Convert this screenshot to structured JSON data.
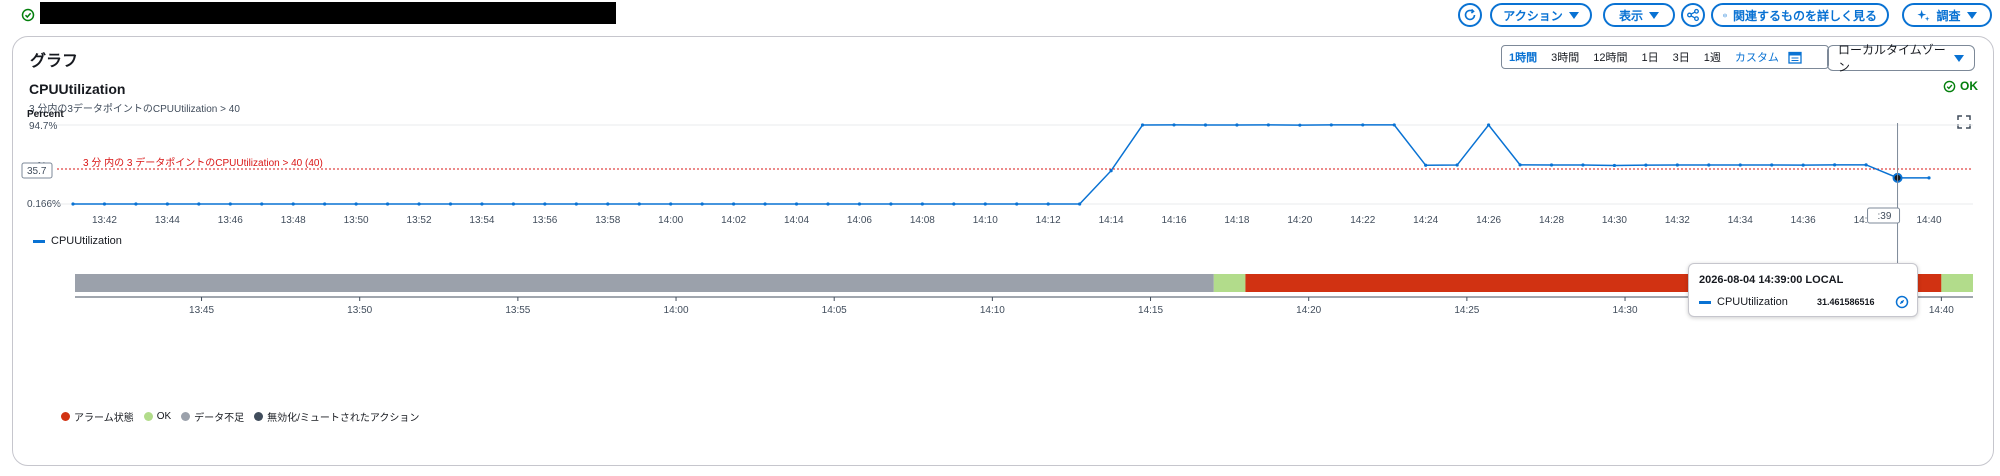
{
  "toolbar": {
    "refresh_icon": "refresh-icon",
    "actions_label": "アクション",
    "view_label": "表示",
    "share_icon": "share-icon",
    "explore_label": "関連するものを詳しく見る",
    "investigate_label": "調査"
  },
  "panel": {
    "title": "グラフ",
    "ranges": [
      "1時間",
      "3時間",
      "12時間",
      "1日",
      "3日",
      "1週"
    ],
    "custom_label": "カスタム",
    "timezone_label": "ローカルタイムゾーン"
  },
  "metric": {
    "title": "CPUUtilization",
    "subtitle": "3 分内の3データポイントのCPUUtilization > 40",
    "status": "OK",
    "y_unit": "Percent",
    "y_top_label": "94.7%",
    "y_mid_label": "...%",
    "y_bottom_label": "0.166%",
    "threshold_label": "3 分 内の 3 データポイントのCPUUtilization > 40 (40)",
    "hover_y_badge": "35.7",
    "hover_x_badge": ":39",
    "legend_series": "CPUUtilization"
  },
  "tooltip": {
    "datetime": "2026-08-04 14:39:00 LOCAL",
    "series": "CPUUtilization",
    "value": "31.461586516"
  },
  "timeline": {
    "legend": [
      {
        "label": "アラーム状態",
        "color": "#d13212"
      },
      {
        "label": "OK",
        "color": "#b2dc8b"
      },
      {
        "label": "データ不足",
        "color": "#9ba1ab"
      },
      {
        "label": "無効化/ミュートされたアクション",
        "color": "#414d5c"
      }
    ],
    "ticks": [
      "13:45",
      "13:50",
      "13:55",
      "14:00",
      "14:05",
      "14:10",
      "14:15",
      "14:20",
      "14:25",
      "14:30",
      "14:35",
      "14:40"
    ],
    "segments": [
      {
        "state": "データ不足",
        "color": "#9ba1ab",
        "from": "13:41",
        "to": "14:17"
      },
      {
        "state": "OK",
        "color": "#b2dc8b",
        "from": "14:17",
        "to": "14:18"
      },
      {
        "state": "アラーム状態",
        "color": "#d13212",
        "from": "14:18",
        "to": "14:40"
      },
      {
        "state": "OK",
        "color": "#b2dc8b",
        "from": "14:40",
        "to": "14:41"
      }
    ]
  },
  "chart_data": {
    "type": "line",
    "title": "CPUUtilization",
    "ylabel": "Percent",
    "threshold": 40,
    "x_tick_labels": [
      "13:42",
      "13:44",
      "13:46",
      "13:48",
      "13:50",
      "13:52",
      "13:54",
      "13:56",
      "13:58",
      "14:00",
      "14:02",
      "14:04",
      "14:06",
      "14:08",
      "14:10",
      "14:12",
      "14:14",
      "14:16",
      "14:18",
      "14:20",
      "14:22",
      "14:24",
      "14:26",
      "14:28",
      "14:30",
      "14:32",
      "14:34",
      "14:36",
      "14:38",
      ":39",
      "14:40"
    ],
    "series": [
      {
        "name": "CPUUtilization",
        "color": "#0972d3",
        "x": [
          "13:41",
          "13:42",
          "13:43",
          "13:44",
          "13:45",
          "13:46",
          "13:47",
          "13:48",
          "13:49",
          "13:50",
          "13:51",
          "13:52",
          "13:53",
          "13:54",
          "13:55",
          "13:56",
          "13:57",
          "13:58",
          "13:59",
          "14:00",
          "14:01",
          "14:02",
          "14:03",
          "14:04",
          "14:05",
          "14:06",
          "14:07",
          "14:08",
          "14:09",
          "14:10",
          "14:11",
          "14:12",
          "14:13",
          "14:14",
          "14:15",
          "14:16",
          "14:17",
          "14:18",
          "14:19",
          "14:20",
          "14:21",
          "14:22",
          "14:23",
          "14:24",
          "14:25",
          "14:26",
          "14:27",
          "14:28",
          "14:29",
          "14:30",
          "14:31",
          "14:32",
          "14:33",
          "14:34",
          "14:35",
          "14:36",
          "14:37",
          "14:38",
          "14:39",
          "14:40"
        ],
        "values": [
          0.166,
          0.166,
          0.166,
          0.166,
          0.166,
          0.166,
          0.166,
          0.166,
          0.166,
          0.166,
          0.166,
          0.166,
          0.166,
          0.166,
          0.166,
          0.166,
          0.166,
          0.166,
          0.166,
          0.166,
          0.166,
          0.166,
          0.166,
          0.166,
          0.166,
          0.166,
          0.166,
          0.166,
          0.166,
          0.166,
          0.166,
          0.166,
          0.166,
          40,
          94.7,
          94.8,
          94.7,
          94.7,
          94.8,
          94.5,
          94.8,
          94.8,
          94.8,
          46.5,
          46.8,
          94.7,
          47.0,
          46.8,
          46.8,
          46.3,
          46.7,
          46.8,
          46.8,
          46.8,
          46.8,
          46.7,
          47.0,
          47.0,
          31.46,
          31.46
        ]
      }
    ]
  }
}
